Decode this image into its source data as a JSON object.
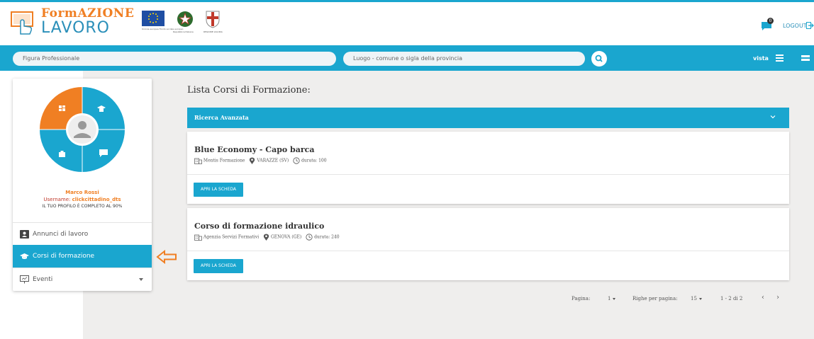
{
  "header": {
    "logo_line1_a": "Form",
    "logo_line1_b": "AZIONE",
    "logo_line2": "LAVORO",
    "eu_caption": "Unione europea Fondo sociale europeo",
    "repub_caption": "Repubblica Italiana",
    "lig_caption": "REGIONE LIGURIA",
    "notifications_count": "0",
    "logout_label": "LOGOUT"
  },
  "search": {
    "profession_placeholder": "Figura Professionale",
    "place_placeholder": "Luogo - comune o sigla della provincia",
    "view_label": "vista"
  },
  "profile": {
    "name": "Marco Rossi",
    "username_label": "Username:",
    "username": "clickcittadino_dts",
    "completion": "IL TUO PROFILO È COMPLETO AL 90%",
    "completion_percent": 90
  },
  "menu": {
    "items": [
      {
        "label": "Annunci di lavoro"
      },
      {
        "label": "Corsi di formazione"
      },
      {
        "label": "Eventi"
      }
    ]
  },
  "content": {
    "title": "Lista Corsi di Formazione:",
    "advanced_search": "Ricerca Avanzata",
    "courses": [
      {
        "title": "Blue Economy - Capo barca",
        "provider": "Mentis Formazione",
        "place": "VARAZZE (SV)",
        "duration": "durata: 100",
        "button": "APRI LA SCHEDA"
      },
      {
        "title": "Corso di formazione idraulico",
        "provider": "Agenzia Servizi Formativi",
        "place": "GENOVA (GE)",
        "duration": "durata: 240",
        "button": "APRI LA SCHEDA"
      }
    ]
  },
  "pager": {
    "page_label": "Pagina:",
    "page_value": "1",
    "rows_label": "Righe per pagina:",
    "rows_value": "15",
    "range": "1 - 2 di 2",
    "prev": "‹",
    "next": "›"
  },
  "colors": {
    "primary": "#1aa6cf",
    "accent": "#f07f23",
    "background": "#efeeed"
  }
}
